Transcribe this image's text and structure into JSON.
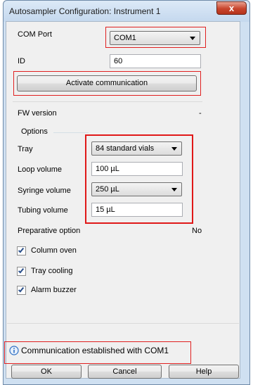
{
  "window": {
    "title": "Autosampler Configuration: Instrument 1",
    "close_glyph": "x"
  },
  "com_port": {
    "label": "COM Port",
    "value": "COM1"
  },
  "id_field": {
    "label": "ID",
    "value": "60"
  },
  "activate_button": {
    "label": "Activate communication"
  },
  "fw_version": {
    "label": "FW version",
    "value": "-"
  },
  "options": {
    "group_label": "Options",
    "tray": {
      "label": "Tray",
      "value": "84 standard vials"
    },
    "loop_volume": {
      "label": "Loop volume",
      "value": "100 µL"
    },
    "syringe_volume": {
      "label": "Syringe volume",
      "value": "250 µL"
    },
    "tubing_volume": {
      "label": "Tubing volume",
      "value": "15 µL"
    },
    "preparative": {
      "label": "Preparative option",
      "value": "No"
    },
    "column_oven": {
      "label": "Column oven",
      "checked": true
    },
    "tray_cooling": {
      "label": "Tray cooling",
      "checked": true
    },
    "alarm_buzzer": {
      "label": "Alarm buzzer",
      "checked": true
    }
  },
  "status": {
    "icon": "info-icon",
    "text": "Communication established with COM1"
  },
  "buttons": {
    "ok": "OK",
    "cancel": "Cancel",
    "help": "Help"
  },
  "colors": {
    "highlight": "#e02020",
    "window_frame": "#cfe0f1",
    "client_bg": "#f0f0f0",
    "info_icon": "#2f6fc4"
  }
}
